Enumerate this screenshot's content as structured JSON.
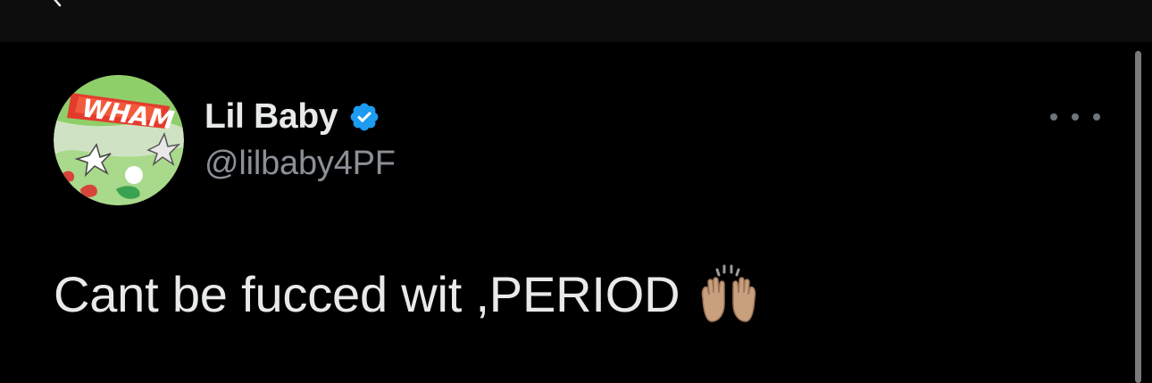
{
  "header": {
    "back_icon": "chevron-left-icon"
  },
  "tweet": {
    "author": {
      "display_name": "Lil Baby",
      "handle": "@lilbaby4PF",
      "verified": true,
      "verified_icon": "verified-badge-icon",
      "avatar_text": "WHAM"
    },
    "text": "Cant be fucced wit ,PERIOD",
    "emoji": "raised-hands-icon",
    "more_icon": "more-horizontal-icon"
  },
  "colors": {
    "background": "#000000",
    "topbar": "#0d0d0d",
    "primary_text": "#e7e9ea",
    "secondary_text": "#8b9096",
    "verified_blue": "#1d9bf0"
  }
}
